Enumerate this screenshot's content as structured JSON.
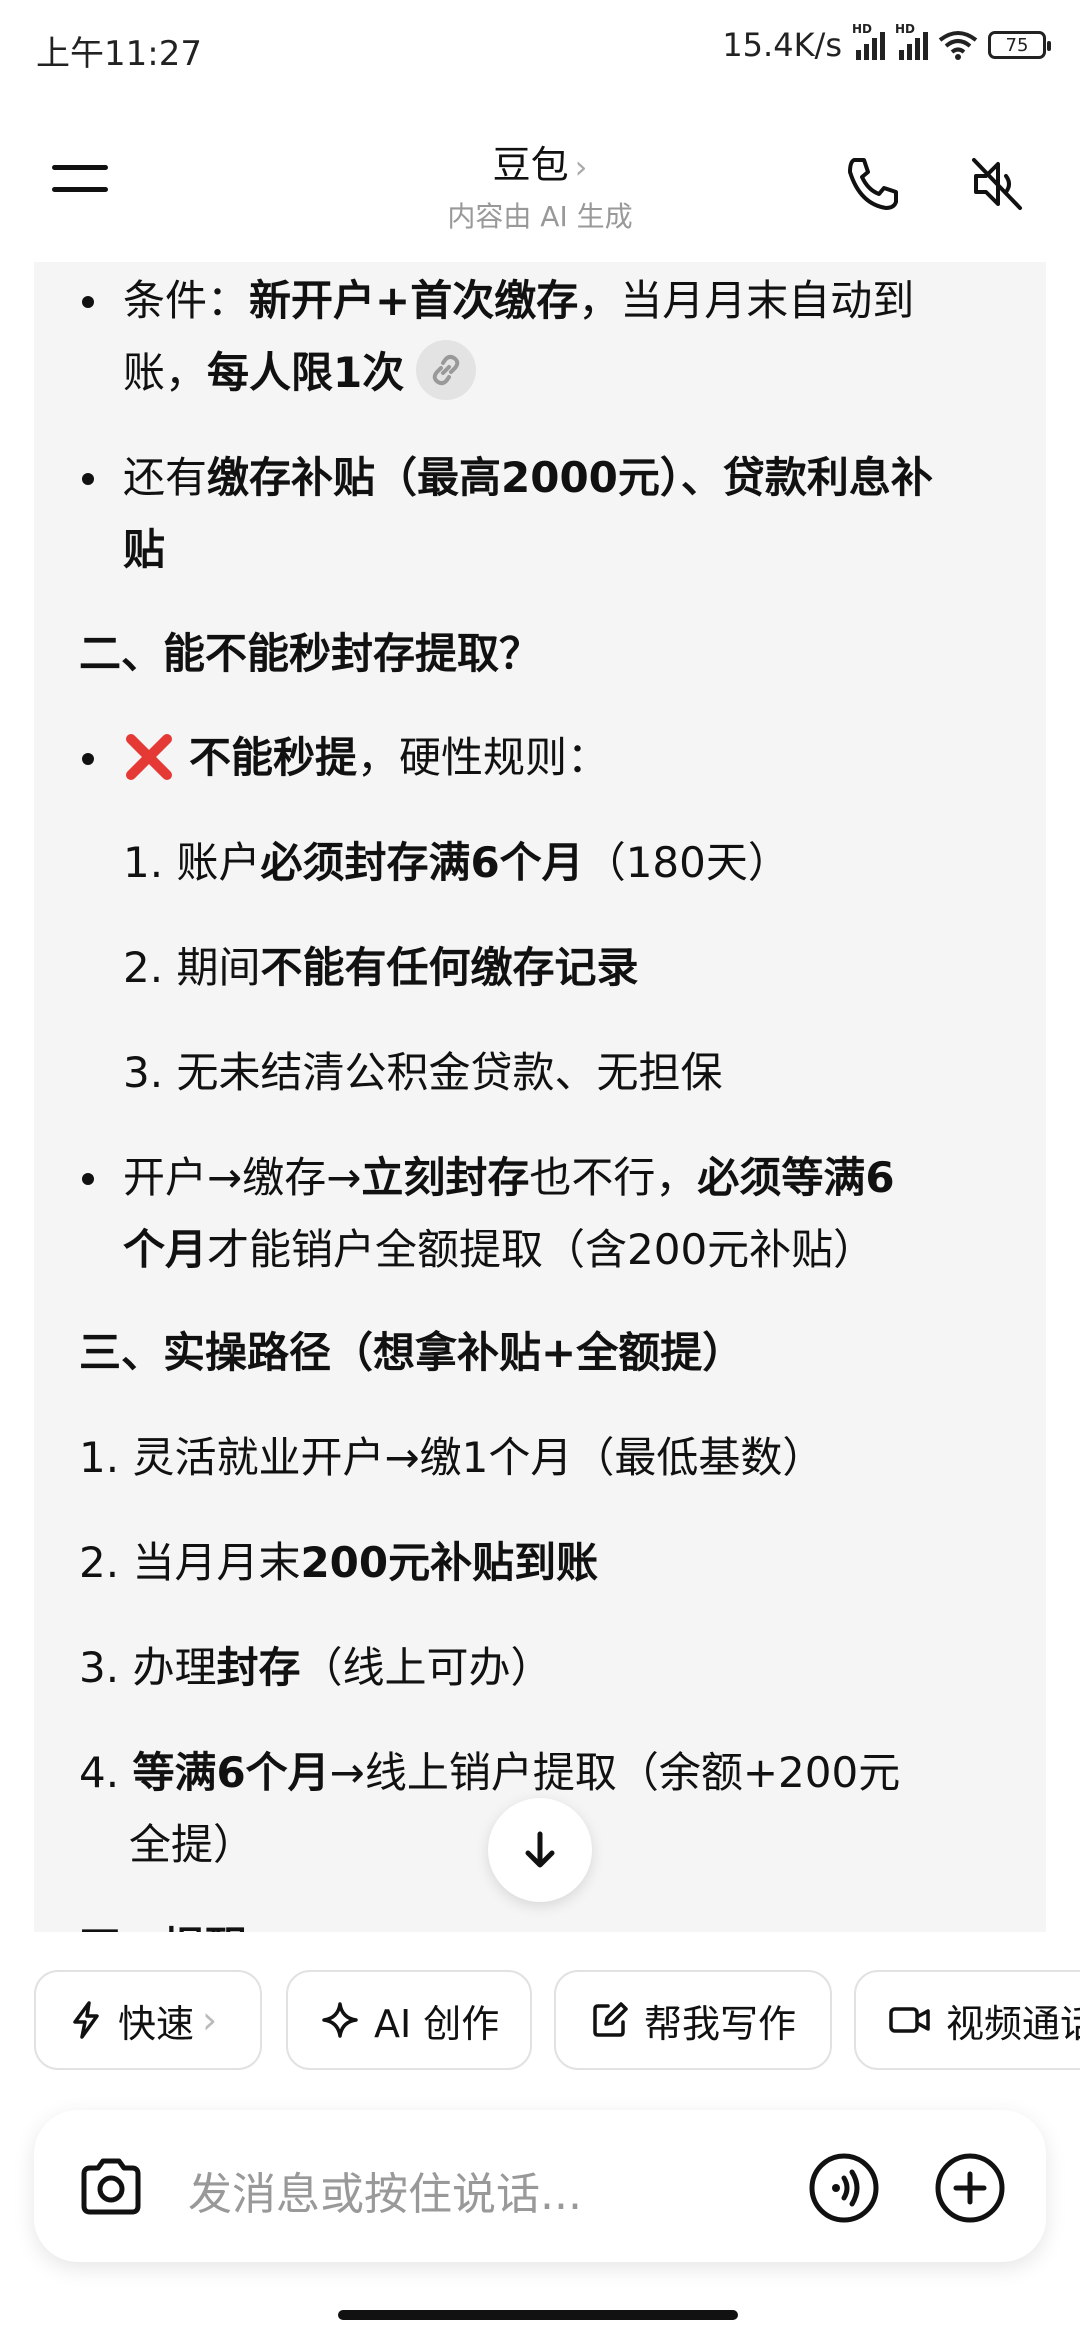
{
  "status_bar": {
    "time": "上午11:27",
    "net_speed": "15.4K/s",
    "signal_badge": "HD",
    "battery": "75"
  },
  "header": {
    "title": "豆包",
    "title_chevron": "›",
    "subtitle": "内容由 AI 生成",
    "icons": [
      "menu-icon",
      "phone-icon",
      "speaker-muted-icon"
    ]
  },
  "message": {
    "b1": {
      "pre": "条件：",
      "strong1": "新开户+首次缴存",
      "mid": "，当月月末自动到",
      "line2": "账，",
      "strong2": "每人限1次"
    },
    "b2": {
      "pre": "还有",
      "strong1": "缴存补贴（最高2000元）、贷款利息补",
      "strong2": "贴"
    },
    "h2": "二、能不能秒封存提取？",
    "b3": {
      "strong": "不能秒提",
      "post": "，硬性规则：",
      "icon": "red-cross-icon"
    },
    "n1": {
      "num": "1.",
      "pre": "账户",
      "strong": "必须封存满6个月",
      "post": "（180天）"
    },
    "n2": {
      "num": "2.",
      "pre": "期间",
      "strong": "不能有任何缴存记录"
    },
    "n3": {
      "num": "3.",
      "text": "无未结清公积金贷款、无担保"
    },
    "b4": {
      "pre": "开户→缴存→",
      "strong1": "立刻封存",
      "mid": "也不行，",
      "strong2": "必须等满6",
      "strong3": "个月",
      "post": "才能销户全额提取（含200元补贴）"
    },
    "h3": "三、实操路径（想拿补贴+全额提）",
    "s1": {
      "num": "1.",
      "text": "灵活就业开户→缴1个月（最低基数）"
    },
    "s2": {
      "num": "2.",
      "pre": "当月月末",
      "strong": "200元补贴到账"
    },
    "s3": {
      "num": "3.",
      "pre": "办理",
      "strong": "封存",
      "post": "（线上可办）"
    },
    "s4": {
      "num": "4.",
      "strong": "等满6个月",
      "post": "→线上销户提取（余额+200元",
      "line2": "全提）"
    },
    "h4_partial": "四、提醒"
  },
  "quick_actions": [
    {
      "label": "快速",
      "icon": "lightning-icon",
      "chevron": "›"
    },
    {
      "label": "AI 创作",
      "icon": "sparkle-icon"
    },
    {
      "label": "帮我写作",
      "icon": "edit-icon"
    },
    {
      "label": "视频通话",
      "icon": "video-icon"
    }
  ],
  "input": {
    "placeholder": "发消息或按住说话..."
  },
  "colors": {
    "accent_red": "#e53935",
    "bg_message": "#f5f5f5",
    "text": "#111111",
    "muted": "#999999"
  }
}
